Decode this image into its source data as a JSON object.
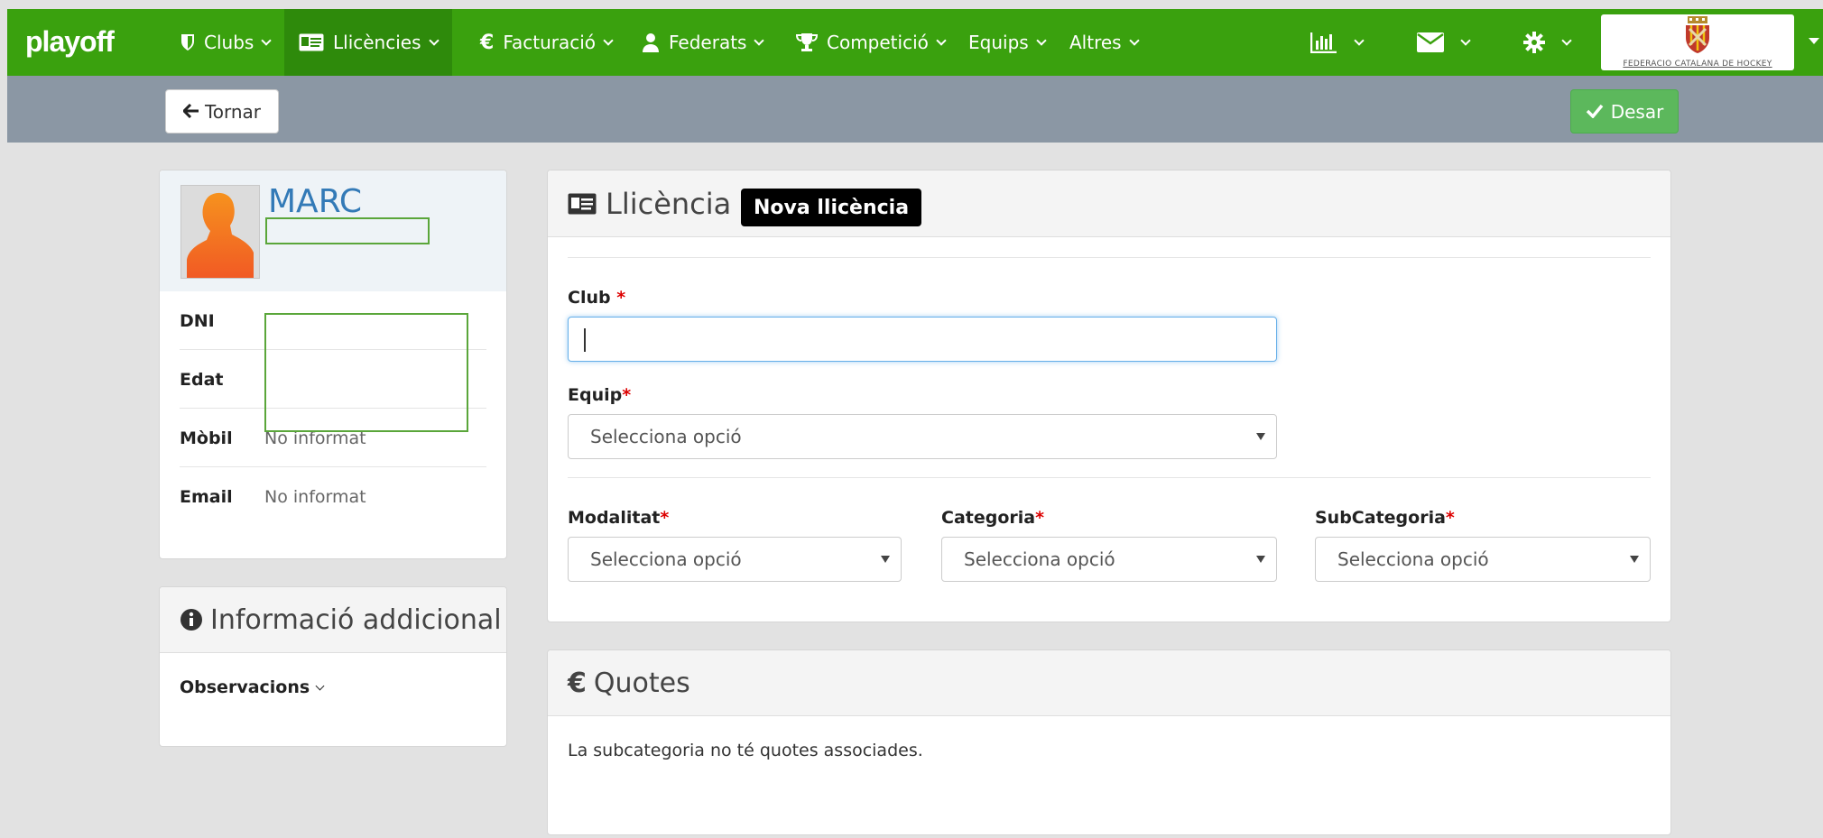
{
  "brand": "playoff",
  "nav": {
    "clubs": "Clubs",
    "llicencies": "Llicències",
    "facturacio": "Facturació",
    "federats": "Federats",
    "competicio": "Competició",
    "equips": "Equips",
    "altres": "Altres",
    "org_logo_text": "FEDERACIÓ CATALANA DE HOCKEY"
  },
  "actions": {
    "back_label": "Tornar",
    "save_label": "Desar"
  },
  "profile": {
    "name": "MARC",
    "rows": [
      {
        "label": "DNI",
        "value": ""
      },
      {
        "label": "Edat",
        "value": ""
      },
      {
        "label": "Mòbil",
        "value": "No informat"
      },
      {
        "label": "Email",
        "value": "No informat"
      }
    ]
  },
  "additional": {
    "title": "Informació addicional",
    "observations": "Observacions"
  },
  "license": {
    "title": "Llicència",
    "badge": "Nova llicència",
    "club_label": "Club",
    "club_value": "",
    "team_label": "Equip",
    "team_value": "Selecciona opció",
    "modality_label": "Modalitat",
    "modality_value": "Selecciona opció",
    "category_label": "Categoria",
    "category_value": "Selecciona opció",
    "subcategory_label": "SubCategoria",
    "subcategory_value": "Selecciona opció",
    "required_mark": "*"
  },
  "quotes": {
    "title": "Quotes",
    "message": "La subcategoria no té quotes associades."
  },
  "colors": {
    "nav_bg": "#3aa10e",
    "nav_active": "#2e8a0b",
    "action_bar": "#8b97a4",
    "save_btn": "#5cb85c",
    "link_blue": "#337ab7"
  }
}
